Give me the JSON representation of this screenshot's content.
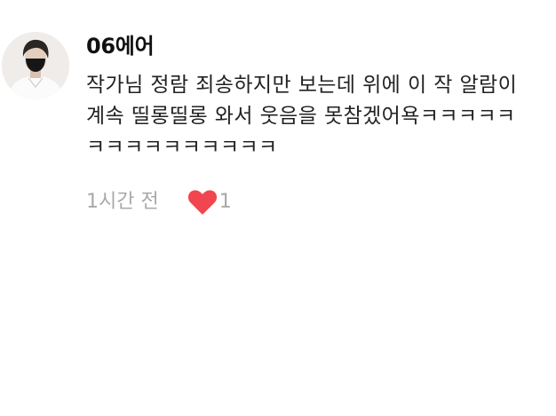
{
  "comment": {
    "author": "06에어",
    "text": "작가님 정람 죄송하지만 보는데 위에 이 작 알람이 계속 띨롱띨롱 와서 웃음을 못참겠어욕ㅋㅋㅋㅋㅋㅋㅋㅋㅋㅋㅋㅋㅋㅋㅋ",
    "time": "1시간 전",
    "likes": "1",
    "like_icon": "heart-icon",
    "like_color": "#f1454f"
  }
}
